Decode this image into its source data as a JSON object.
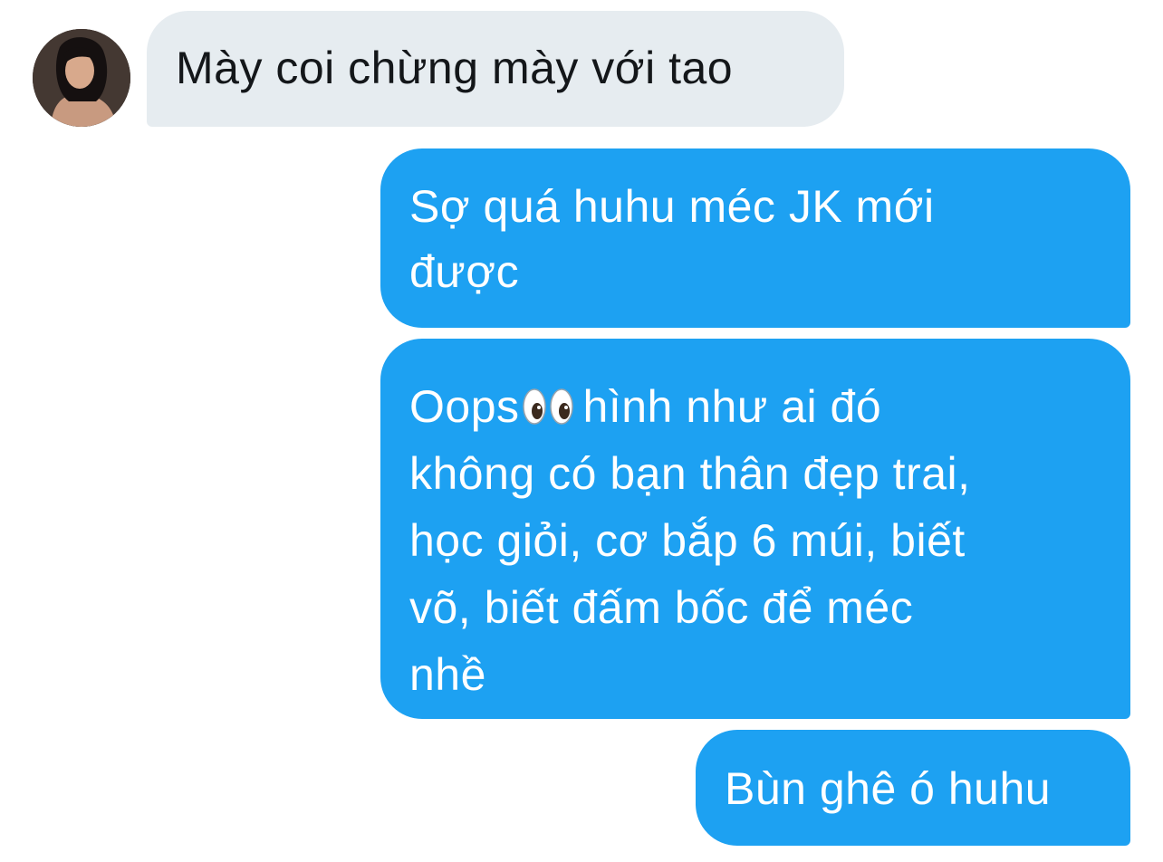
{
  "conversation": {
    "contact_avatar": "avatar-photo",
    "messages": [
      {
        "direction": "incoming",
        "text": "Mày coi chừng mày với tao"
      },
      {
        "direction": "outgoing",
        "lines": [
          "Sợ quá huhu méc JK mới",
          "được"
        ]
      },
      {
        "direction": "outgoing",
        "lines_before_emoji": "Oops",
        "emoji": "eyes-emoji",
        "lines": [
          "hình như ai đó",
          "không có bạn thân đẹp trai,",
          "học giỏi, cơ bắp 6 múi, biết",
          "võ, biết đấm bốc để méc",
          "nhề"
        ]
      },
      {
        "direction": "outgoing",
        "text": "Bùn ghê ó huhu"
      }
    ]
  },
  "colors": {
    "incoming_bubble": "#e6ecf0",
    "incoming_text": "#14171a",
    "outgoing_bubble": "#1da1f2",
    "outgoing_text": "#ffffff"
  }
}
